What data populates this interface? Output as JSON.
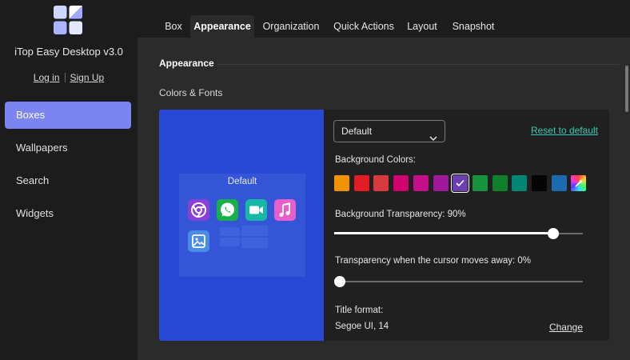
{
  "app": {
    "title": "iTop Easy Desktop v3.0"
  },
  "auth": {
    "login": "Log in",
    "signup": "Sign Up"
  },
  "sidebar": {
    "items": [
      {
        "label": "Boxes",
        "active": true
      },
      {
        "label": "Wallpapers",
        "active": false
      },
      {
        "label": "Search",
        "active": false
      },
      {
        "label": "Widgets",
        "active": false
      }
    ]
  },
  "tabs": [
    {
      "label": "Box"
    },
    {
      "label": "Appearance",
      "active": true
    },
    {
      "label": "Organization"
    },
    {
      "label": "Quick Actions"
    },
    {
      "label": "Layout"
    },
    {
      "label": "Snapshot"
    }
  ],
  "appearance": {
    "section_title": "Appearance",
    "subsection_title": "Colors & Fonts",
    "preview": {
      "box_title": "Default"
    },
    "theme_dropdown": {
      "value": "Default"
    },
    "reset_link": "Reset to default",
    "background_colors_label": "Background Colors:",
    "swatches": [
      "#f39200",
      "#e31b23",
      "#d63a3e",
      "#d1006f",
      "#c40f8a",
      "#a0189c",
      "#6b3fb0",
      "#16933f",
      "#0f7f2a",
      "#008774",
      "#050505",
      "#1a6bb0",
      "custom-picker"
    ],
    "selected_swatch": "#6b3fb0",
    "bg_transparency_label": "Background Transparency: 90%",
    "bg_transparency_value": 0.9,
    "cursor_transparency_label": "Transparency when the cursor moves away: 0%",
    "cursor_transparency_value": 0.0,
    "title_format_label": "Title format:",
    "title_format_value": "Segoe UI, 14",
    "change_link": "Change"
  },
  "colors": {
    "accent": "#7b84f0",
    "link": "#38c9b5",
    "preview_bg": "#2a48d6"
  },
  "icons": [
    "app-logo-icon",
    "chrome-icon",
    "whatsapp-icon",
    "video-camera-icon",
    "music-icon",
    "image-icon",
    "chevron-down-icon",
    "check-icon",
    "color-picker-icon"
  ]
}
